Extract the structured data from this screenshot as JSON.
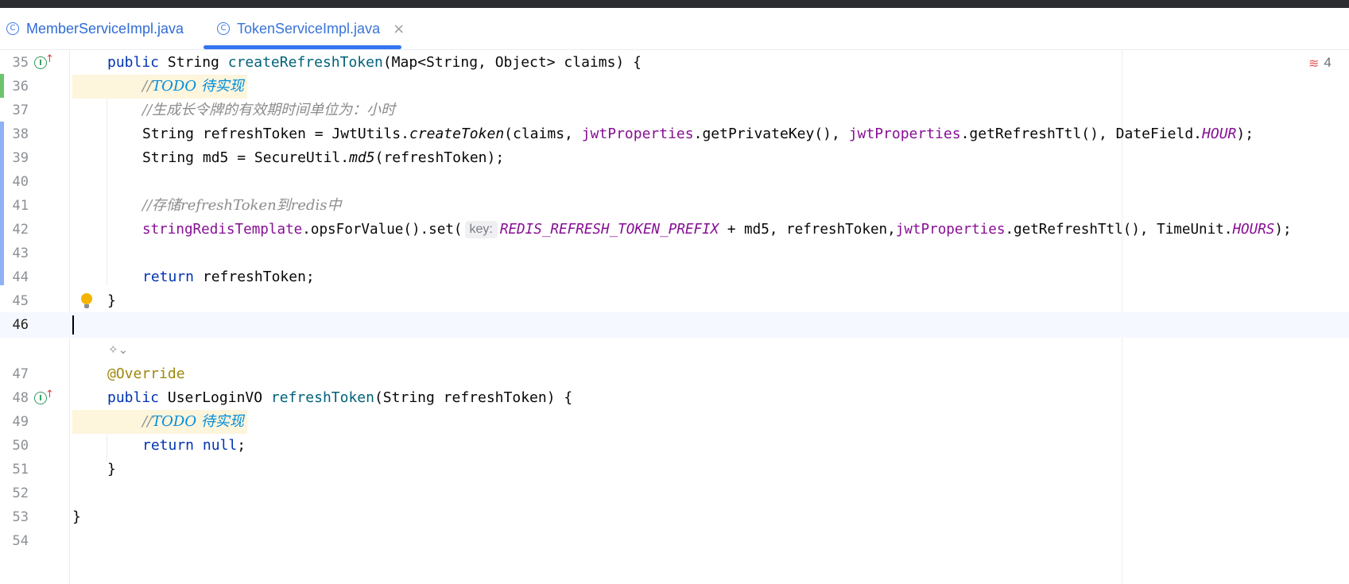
{
  "tabs": [
    {
      "label": "MemberServiceImpl.java",
      "active": false
    },
    {
      "label": "TokenServiceImpl.java",
      "active": true
    }
  ],
  "tab_close": "×",
  "problems": {
    "count": "4"
  },
  "icons": {
    "tab_file": "class-c-icon",
    "implements": "implements-interface-icon",
    "bulb": "lightbulb-icon",
    "ai_lens": "code-lens-icon",
    "problems": "error-wave-icon"
  },
  "hint_key": "key:",
  "lines": [
    {
      "n": "35"
    },
    {
      "n": "36"
    },
    {
      "n": "37"
    },
    {
      "n": "38"
    },
    {
      "n": "39"
    },
    {
      "n": "40"
    },
    {
      "n": "41"
    },
    {
      "n": "42"
    },
    {
      "n": "43"
    },
    {
      "n": "44"
    },
    {
      "n": "45"
    },
    {
      "n": "46"
    },
    {
      "n": "47"
    },
    {
      "n": "48"
    },
    {
      "n": "49"
    },
    {
      "n": "50"
    },
    {
      "n": "51"
    },
    {
      "n": "52"
    },
    {
      "n": "53"
    },
    {
      "n": "54"
    }
  ],
  "code": {
    "l35": {
      "public": "public",
      "string": "String",
      "name": "createRefreshToken",
      "rest": "(Map<String, Object> claims) {"
    },
    "l36": {
      "slashes": "//",
      "todo": "TODO 待实现"
    },
    "l37": {
      "comment": "//生成长令牌的有效期时间单位为：小时"
    },
    "l38": {
      "a": "String refreshToken = JwtUtils.",
      "b": "createToken",
      "c": "(claims, ",
      "d": "jwtProperties",
      "e": ".getPrivateKey(), ",
      "f": "jwtProperties",
      "g": ".getRefreshTtl(), DateField.",
      "h": "HOUR",
      "i": ");"
    },
    "l39": {
      "a": "String md5 = SecureUtil.",
      "b": "md5",
      "c": "(refreshToken);"
    },
    "l41": {
      "comment": "//存储refreshToken到redis中"
    },
    "l42": {
      "a": "stringRedisTemplate",
      "b": ".opsForValue().set(",
      "c": "REDIS_REFRESH_TOKEN_PREFIX",
      "d": " + md5, refreshToken,",
      "e": "jwtProperties",
      "f": ".getRefreshTtl(), TimeUnit.",
      "g": "HOURS",
      "h": ");"
    },
    "l44": {
      "kw": "return",
      "rest": " refreshToken;"
    },
    "l45": {
      "brace": "}"
    },
    "l47": {
      "ann": "@Override"
    },
    "l48": {
      "public": "public",
      "rest1": " UserLoginVO ",
      "name": "refreshToken",
      "rest2": "(String refreshToken) {"
    },
    "l49": {
      "slashes": "//",
      "todo": "TODO 待实现"
    },
    "l50": {
      "kw": "return",
      "sp": " ",
      "null": "null",
      "semi": ";"
    },
    "l51": {
      "brace": "}"
    },
    "l53": {
      "brace": "}"
    }
  },
  "colors": {
    "keyword": "#0033b3",
    "method": "#00627a",
    "field": "#871094",
    "comment": "#8c8c8c",
    "todo": "#008dde",
    "annotation": "#9e880d",
    "accent": "#3574f0"
  }
}
